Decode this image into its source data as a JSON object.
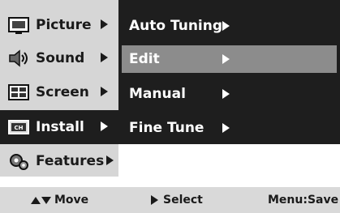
{
  "main_menu": {
    "items": [
      {
        "label": "Picture",
        "icon": "picture-icon",
        "selected": false
      },
      {
        "label": "Sound",
        "icon": "sound-icon",
        "selected": false
      },
      {
        "label": "Screen",
        "icon": "screen-icon",
        "selected": false
      },
      {
        "label": "Install",
        "icon": "install-icon",
        "selected": true
      },
      {
        "label": "Features",
        "icon": "features-icon",
        "selected": false
      }
    ],
    "install_icon_text": "CH"
  },
  "submenu": {
    "items": [
      {
        "label": "Auto Tuning",
        "highlighted": false
      },
      {
        "label": "Edit",
        "highlighted": true
      },
      {
        "label": "Manual",
        "highlighted": false
      },
      {
        "label": "Fine Tune",
        "highlighted": false
      }
    ]
  },
  "footer": {
    "move_label": "Move",
    "select_label": "Select",
    "save_label": "Menu:Save"
  },
  "colors": {
    "menu_bg": "#d6d6d6",
    "panel_bg": "#1e1e1e",
    "highlight": "#8c8c8c",
    "footer_bg": "#d9d9d9"
  }
}
